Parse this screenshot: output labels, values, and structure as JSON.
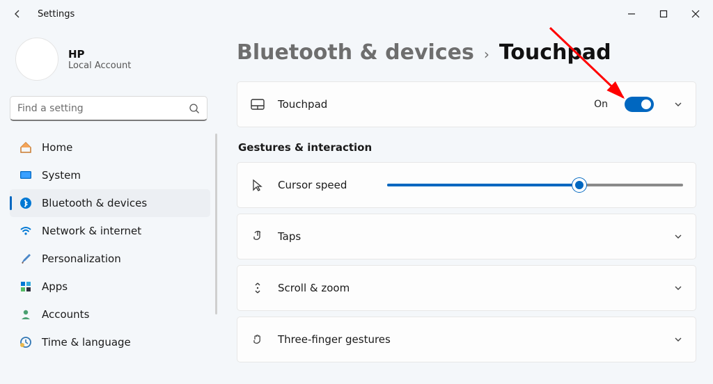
{
  "window": {
    "title": "Settings"
  },
  "profile": {
    "name": "HP",
    "account": "Local Account"
  },
  "search": {
    "placeholder": "Find a setting"
  },
  "sidebar": {
    "items": [
      {
        "label": "Home"
      },
      {
        "label": "System"
      },
      {
        "label": "Bluetooth & devices"
      },
      {
        "label": "Network & internet"
      },
      {
        "label": "Personalization"
      },
      {
        "label": "Apps"
      },
      {
        "label": "Accounts"
      },
      {
        "label": "Time & language"
      }
    ],
    "active_index": 2
  },
  "breadcrumb": {
    "parent": "Bluetooth & devices",
    "current": "Touchpad"
  },
  "touchpad_card": {
    "label": "Touchpad",
    "state": "On",
    "on": true
  },
  "section_header": "Gestures & interaction",
  "cursor_speed": {
    "label": "Cursor speed",
    "value_percent": 65
  },
  "rows": [
    {
      "label": "Taps"
    },
    {
      "label": "Scroll & zoom"
    },
    {
      "label": "Three-finger gestures"
    }
  ]
}
